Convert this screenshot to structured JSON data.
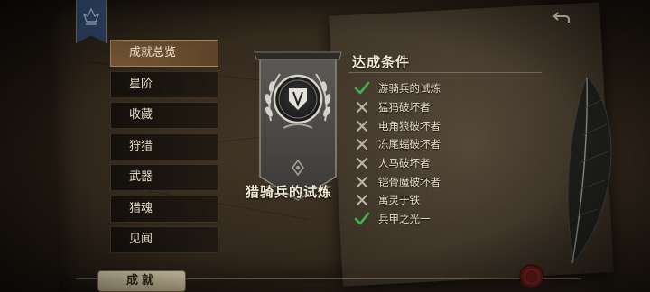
{
  "sidebar": {
    "items": [
      {
        "label": "成就总览",
        "active": true
      },
      {
        "label": "星阶",
        "active": false
      },
      {
        "label": "收藏",
        "active": false
      },
      {
        "label": "狩猎",
        "active": false
      },
      {
        "label": "武器",
        "active": false
      },
      {
        "label": "猎魂",
        "active": false
      },
      {
        "label": "见闻",
        "active": false
      }
    ]
  },
  "achievement": {
    "title": "猎骑兵的试炼",
    "emblem_icon": "laurel-crest-banner-icon"
  },
  "conditions": {
    "heading": "达成条件",
    "items": [
      {
        "label": "游骑兵的试炼",
        "completed": true
      },
      {
        "label": "猛犸破坏者",
        "completed": false
      },
      {
        "label": "电角狼破坏者",
        "completed": false
      },
      {
        "label": "冻尾蝠破坏者",
        "completed": false
      },
      {
        "label": "人马破坏者",
        "completed": false
      },
      {
        "label": "铠骨魔破坏者",
        "completed": false
      },
      {
        "label": "寓灵于铁",
        "completed": false
      },
      {
        "label": "兵甲之光一",
        "completed": true
      }
    ]
  },
  "bottom_tab": {
    "label": "成就"
  },
  "icons": {
    "back": "back-arrow-icon",
    "check": "check-icon",
    "cross": "cross-icon",
    "seal": "wax-seal-icon",
    "quill": "quill-icon",
    "banner": "guild-banner-icon"
  },
  "colors": {
    "accent_active": "#7a5a37",
    "check_green": "#3fb34a",
    "cross_gray": "#b9b4aa",
    "banner_blue": "#34507c"
  }
}
